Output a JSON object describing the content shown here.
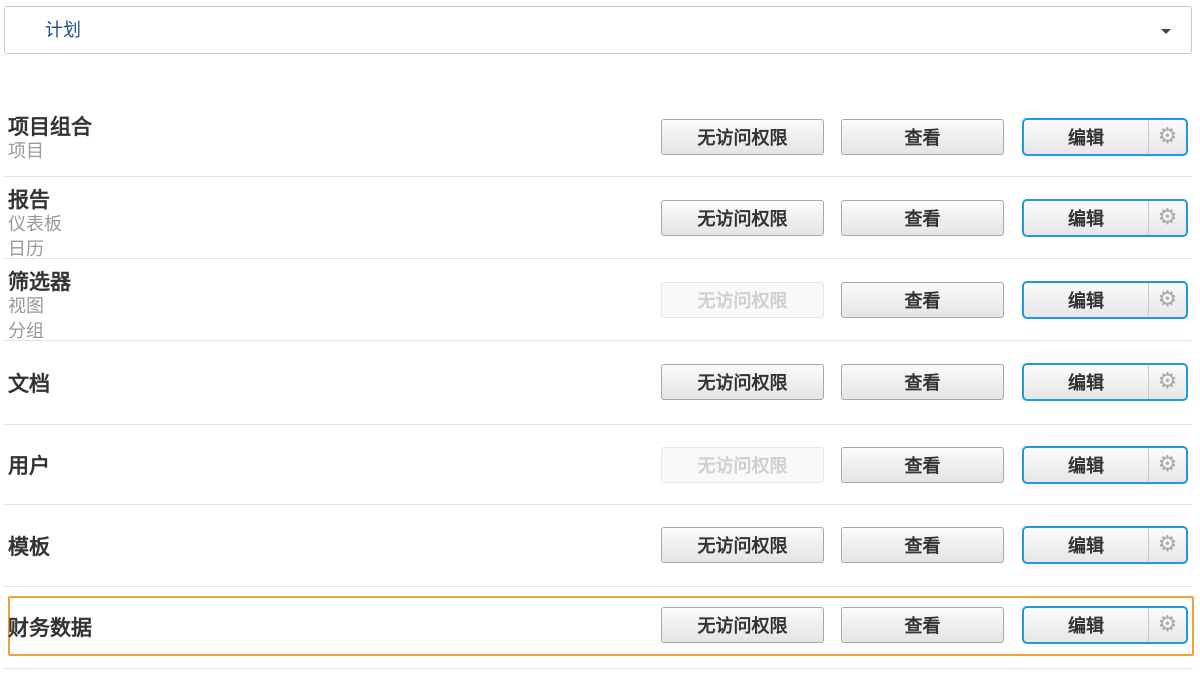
{
  "selector": {
    "value": "计划"
  },
  "rows": [
    {
      "title": "项目组合",
      "subs": [
        "项目"
      ],
      "none_label": "无访问权限",
      "none_disabled": false,
      "view_label": "查看",
      "edit_label": "编辑"
    },
    {
      "title": "报告",
      "subs": [
        "仪表板",
        "日历"
      ],
      "none_label": "无访问权限",
      "none_disabled": false,
      "view_label": "查看",
      "edit_label": "编辑"
    },
    {
      "title": "筛选器",
      "subs": [
        "视图",
        "分组"
      ],
      "none_label": "无访问权限",
      "none_disabled": true,
      "view_label": "查看",
      "edit_label": "编辑"
    },
    {
      "title": "文档",
      "subs": [],
      "none_label": "无访问权限",
      "none_disabled": false,
      "view_label": "查看",
      "edit_label": "编辑"
    },
    {
      "title": "用户",
      "subs": [],
      "none_label": "无访问权限",
      "none_disabled": true,
      "view_label": "查看",
      "edit_label": "编辑"
    },
    {
      "title": "模板",
      "subs": [],
      "none_label": "无访问权限",
      "none_disabled": false,
      "view_label": "查看",
      "edit_label": "编辑"
    },
    {
      "title": "财务数据",
      "subs": [],
      "none_label": "无访问权限",
      "none_disabled": false,
      "view_label": "查看",
      "edit_label": "编辑"
    }
  ],
  "colors": {
    "accent": "#1d9bd8",
    "highlight": "#f0a13c"
  },
  "icons": {
    "settings": "gear-icon",
    "dropdown": "chevron-down-icon"
  }
}
